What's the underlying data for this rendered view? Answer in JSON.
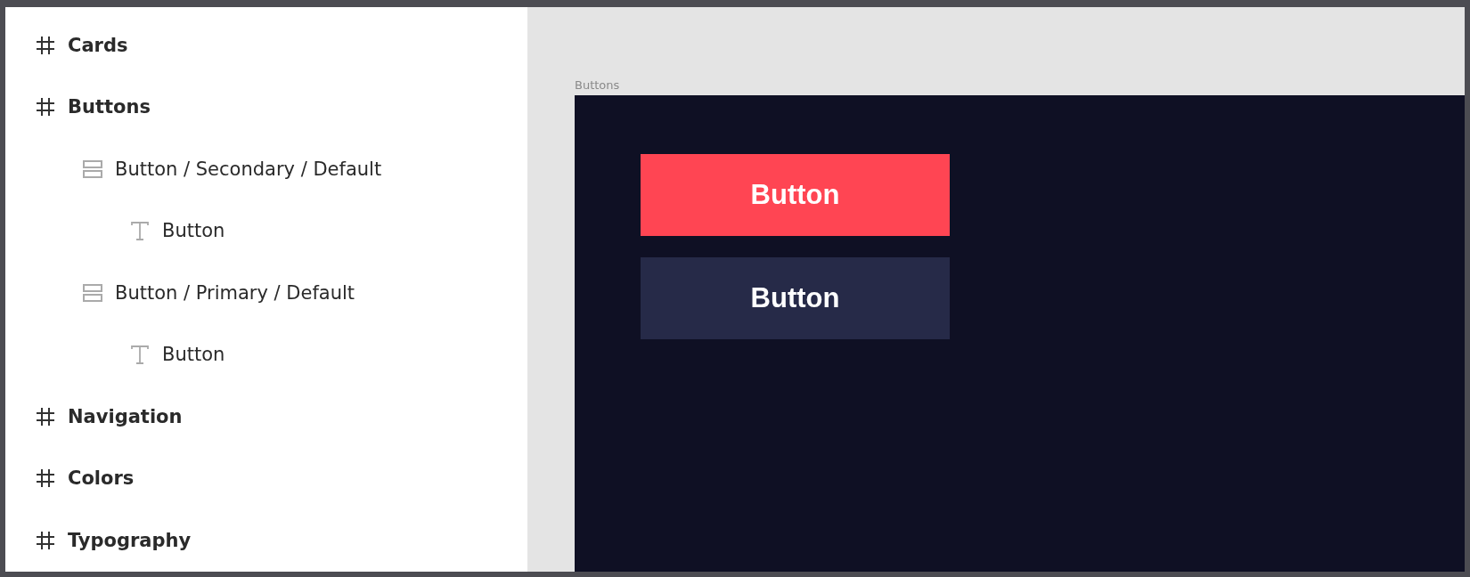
{
  "layers": [
    {
      "kind": "frame",
      "name": "Cards"
    },
    {
      "kind": "frame",
      "name": "Buttons",
      "children": [
        {
          "kind": "component",
          "name": "Button / Secondary / Default",
          "children": [
            {
              "kind": "text",
              "name": "Button"
            }
          ]
        },
        {
          "kind": "component",
          "name": "Button / Primary / Default",
          "children": [
            {
              "kind": "text",
              "name": "Button"
            }
          ]
        }
      ]
    },
    {
      "kind": "frame",
      "name": "Navigation"
    },
    {
      "kind": "frame",
      "name": "Colors"
    },
    {
      "kind": "frame",
      "name": "Typography"
    }
  ],
  "canvas": {
    "frame_label": "Buttons",
    "buttons": [
      {
        "kind": "secondary",
        "label": "Button"
      },
      {
        "kind": "primary",
        "label": "Button"
      }
    ]
  }
}
